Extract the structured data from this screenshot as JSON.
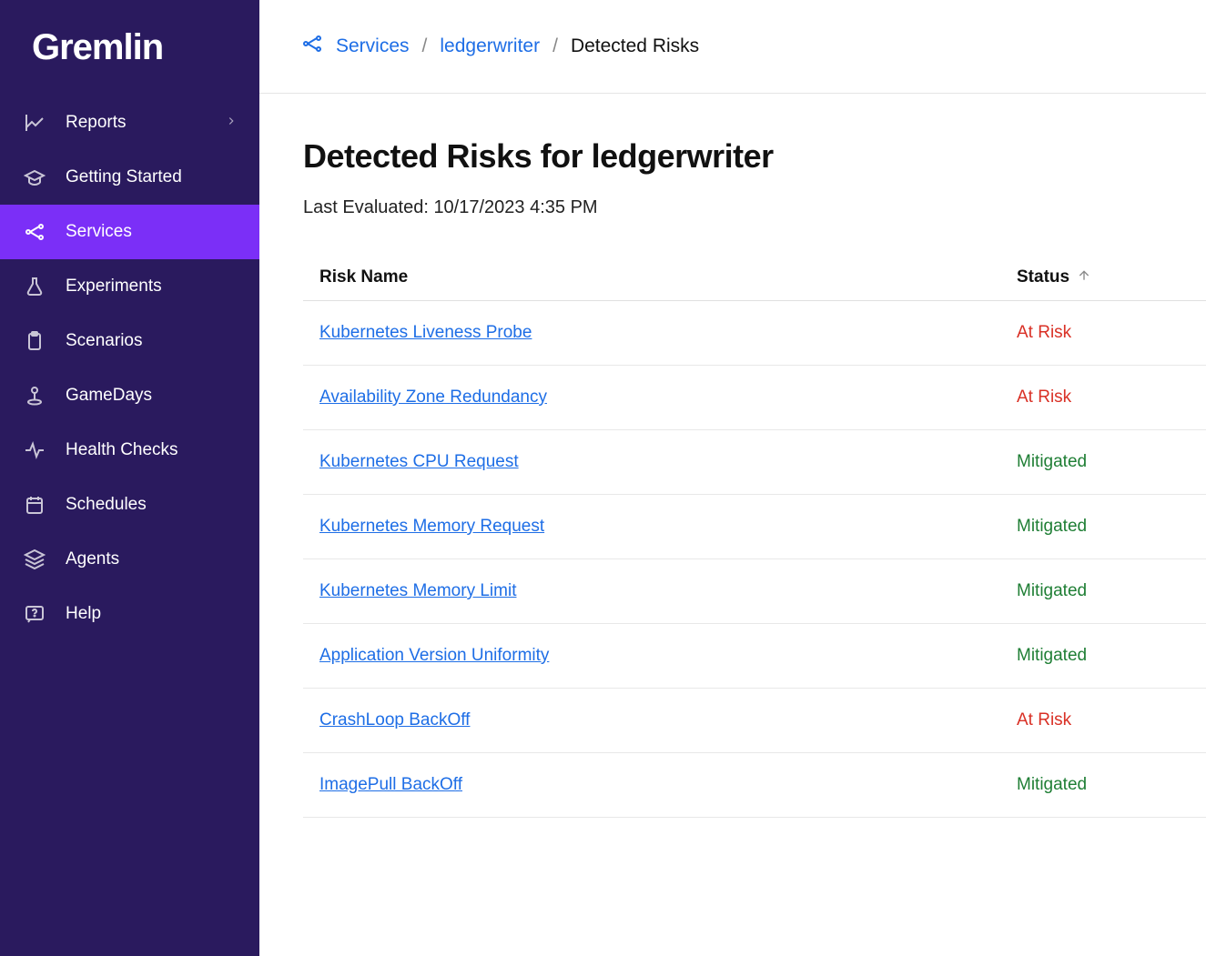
{
  "logo": "Gremlin",
  "sidebar": {
    "items": [
      {
        "label": "Reports",
        "icon": "chart",
        "hasChevron": true
      },
      {
        "label": "Getting Started",
        "icon": "grad-cap"
      },
      {
        "label": "Services",
        "icon": "network",
        "active": true
      },
      {
        "label": "Experiments",
        "icon": "flask"
      },
      {
        "label": "Scenarios",
        "icon": "clipboard"
      },
      {
        "label": "GameDays",
        "icon": "joystick"
      },
      {
        "label": "Health Checks",
        "icon": "pulse"
      },
      {
        "label": "Schedules",
        "icon": "calendar"
      },
      {
        "label": "Agents",
        "icon": "layers"
      },
      {
        "label": "Help",
        "icon": "help"
      }
    ]
  },
  "breadcrumb": {
    "services_label": "Services",
    "service_name": "ledgerwriter",
    "current": "Detected Risks"
  },
  "page": {
    "title": "Detected Risks for ledgerwriter",
    "last_evaluated_label": "Last Evaluated: ",
    "last_evaluated_value": "10/17/2023 4:35 PM"
  },
  "table": {
    "col_name": "Risk Name",
    "col_status": "Status",
    "rows": [
      {
        "name": "Kubernetes Liveness Probe",
        "status": "At Risk",
        "status_class": "at-risk"
      },
      {
        "name": "Availability Zone Redundancy",
        "status": "At Risk",
        "status_class": "at-risk"
      },
      {
        "name": "Kubernetes CPU Request",
        "status": "Mitigated",
        "status_class": "mitigated"
      },
      {
        "name": "Kubernetes Memory Request",
        "status": "Mitigated",
        "status_class": "mitigated"
      },
      {
        "name": "Kubernetes Memory Limit",
        "status": "Mitigated",
        "status_class": "mitigated"
      },
      {
        "name": "Application Version Uniformity",
        "status": "Mitigated",
        "status_class": "mitigated"
      },
      {
        "name": "CrashLoop BackOff",
        "status": "At Risk",
        "status_class": "at-risk"
      },
      {
        "name": "ImagePull BackOff",
        "status": "Mitigated",
        "status_class": "mitigated"
      }
    ]
  }
}
